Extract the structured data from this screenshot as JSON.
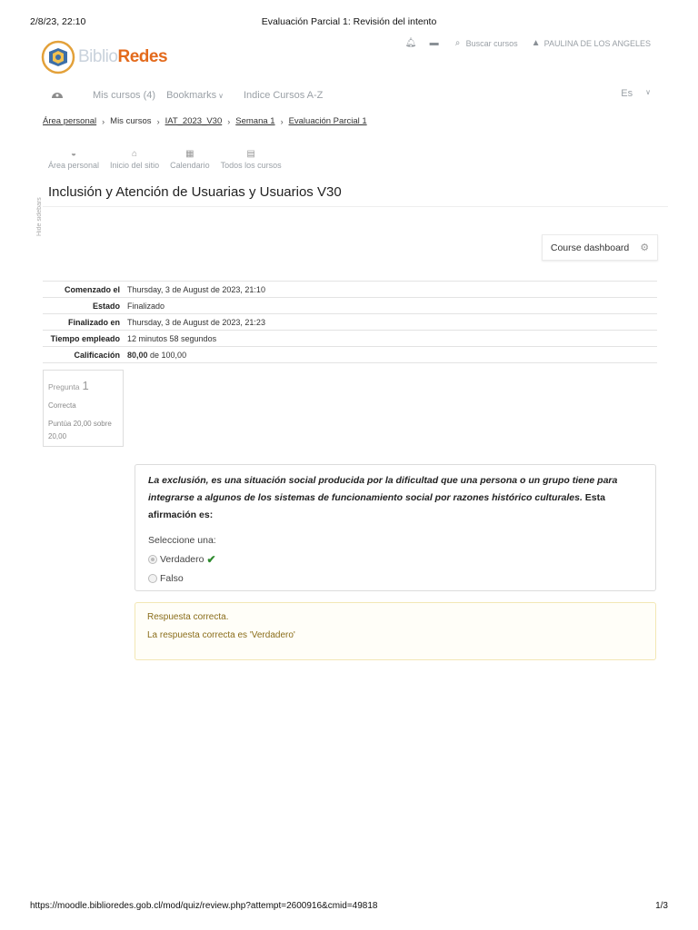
{
  "print": {
    "date": "2/8/23, 22:10",
    "title": "Evaluación Parcial 1: Revisión del intento",
    "url": "https://moodle.biblioredes.gob.cl/mod/quiz/review.php?attempt=2600916&cmid=49818",
    "page": "1/3"
  },
  "logo": {
    "part1": "Biblio",
    "part2": "Redes"
  },
  "topnav": {
    "search": "Buscar cursos",
    "user": "PAULINA DE LOS ANGELES",
    "icons": [
      "bell-icon",
      "chat-icon",
      "search-icon",
      "user-icon"
    ]
  },
  "mainmenu": {
    "items": [
      "Mis cursos (4)",
      "Bookmarks",
      "Indice Cursos A-Z"
    ],
    "lang": "Es"
  },
  "breadcrumb": [
    "Área personal",
    "Mis cursos",
    "IAT_2023_V30",
    "Semana 1",
    "Evaluación Parcial 1"
  ],
  "quicknav": [
    "Área personal",
    "Inicio del sitio",
    "Calendario",
    "Todos los cursos"
  ],
  "sidebar_label": "Hide sidebars",
  "heading": "Inclusión y Atención de Usuarias y Usuarios V30",
  "dashboard_button": "Course dashboard",
  "summary": [
    {
      "k": "Comenzado el",
      "v": "Thursday, 3 de August de 2023, 21:10"
    },
    {
      "k": "Estado",
      "v": "Finalizado"
    },
    {
      "k": "Finalizado en",
      "v": "Thursday, 3 de August de 2023, 21:23"
    },
    {
      "k": "Tiempo empleado",
      "v": "12 minutos 58 segundos"
    },
    {
      "k": "Calificación",
      "score": "80,00",
      "rest": " de 100,00"
    }
  ],
  "question_info": {
    "label": "Pregunta",
    "number": "1",
    "state": "Correcta",
    "mark": "Puntúa 20,00 sobre 20,00"
  },
  "question": {
    "text_italic": "La exclusión, es una situación social producida por la dificultad que una persona o un grupo tiene para integrarse a algunos de los sistemas de funcionamiento social por razones histórico culturales.",
    "text_tail": " Esta afirmación es:",
    "prompt": "Seleccione una:",
    "options": [
      "Verdadero",
      "Falso"
    ],
    "selected": "Verdadero"
  },
  "feedback": {
    "line1": "Respuesta correcta.",
    "line2": "La respuesta correcta es 'Verdadero'"
  }
}
